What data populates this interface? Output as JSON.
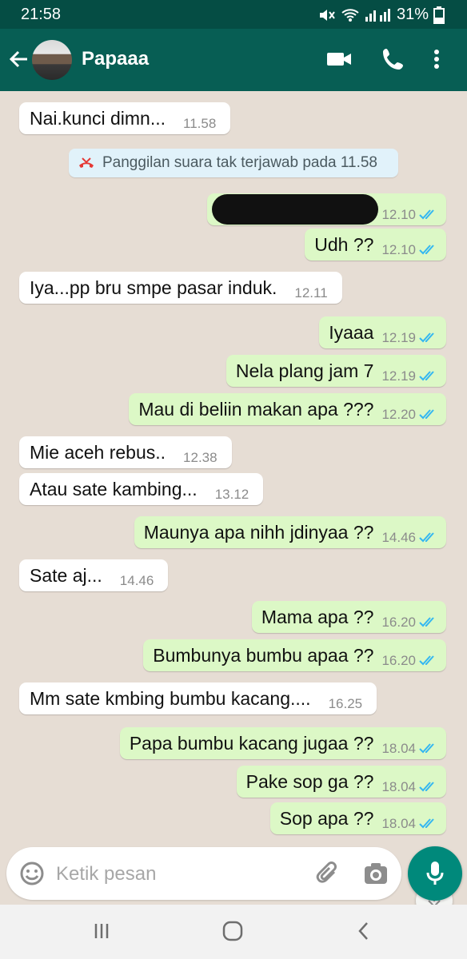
{
  "status_bar": {
    "time": "21:58",
    "battery": "31%"
  },
  "header": {
    "contact_name": "Papaaa"
  },
  "system_message": "Panggilan suara tak terjawab pada 11.58",
  "messages": [
    {
      "dir": "in",
      "text": "Nai.kunci dimn...",
      "time": "11.58"
    },
    {
      "dir": "out",
      "text": "",
      "time": "12.10",
      "redacted": true
    },
    {
      "dir": "out",
      "text": "Udh ??",
      "time": "12.10"
    },
    {
      "dir": "in",
      "text": "Iya...pp bru smpe pasar induk.",
      "time": "12.11"
    },
    {
      "dir": "out",
      "text": "Iyaaa",
      "time": "12.19"
    },
    {
      "dir": "out",
      "text": "Nela plang jam 7",
      "time": "12.19"
    },
    {
      "dir": "out",
      "text": "Mau di beliin makan apa ???",
      "time": "12.20"
    },
    {
      "dir": "in",
      "text": "Mie aceh rebus..",
      "time": "12.38"
    },
    {
      "dir": "in",
      "text": "Atau sate kambing...",
      "time": "13.12"
    },
    {
      "dir": "out",
      "text": "Maunya apa nihh jdinyaa ??",
      "time": "14.46"
    },
    {
      "dir": "in",
      "text": "Sate aj...",
      "time": "14.46"
    },
    {
      "dir": "out",
      "text": "Mama apa ??",
      "time": "16.20"
    },
    {
      "dir": "out",
      "text": "Bumbunya bumbu apaa ??",
      "time": "16.20"
    },
    {
      "dir": "in",
      "text": "Mm sate kmbing bumbu kacang....",
      "time": "16.25"
    },
    {
      "dir": "out",
      "text": "Papa bumbu kacang jugaa ??",
      "time": "18.04"
    },
    {
      "dir": "out",
      "text": "Pake sop ga ??",
      "time": "18.04"
    },
    {
      "dir": "out",
      "text": "Sop apa ??",
      "time": "18.04"
    }
  ],
  "composer": {
    "placeholder": "Ketik pesan"
  },
  "colors": {
    "header": "#075e54",
    "outgoing": "#dcf8c6",
    "incoming": "#ffffff",
    "tick": "#34b7f1",
    "fab": "#00897b"
  }
}
